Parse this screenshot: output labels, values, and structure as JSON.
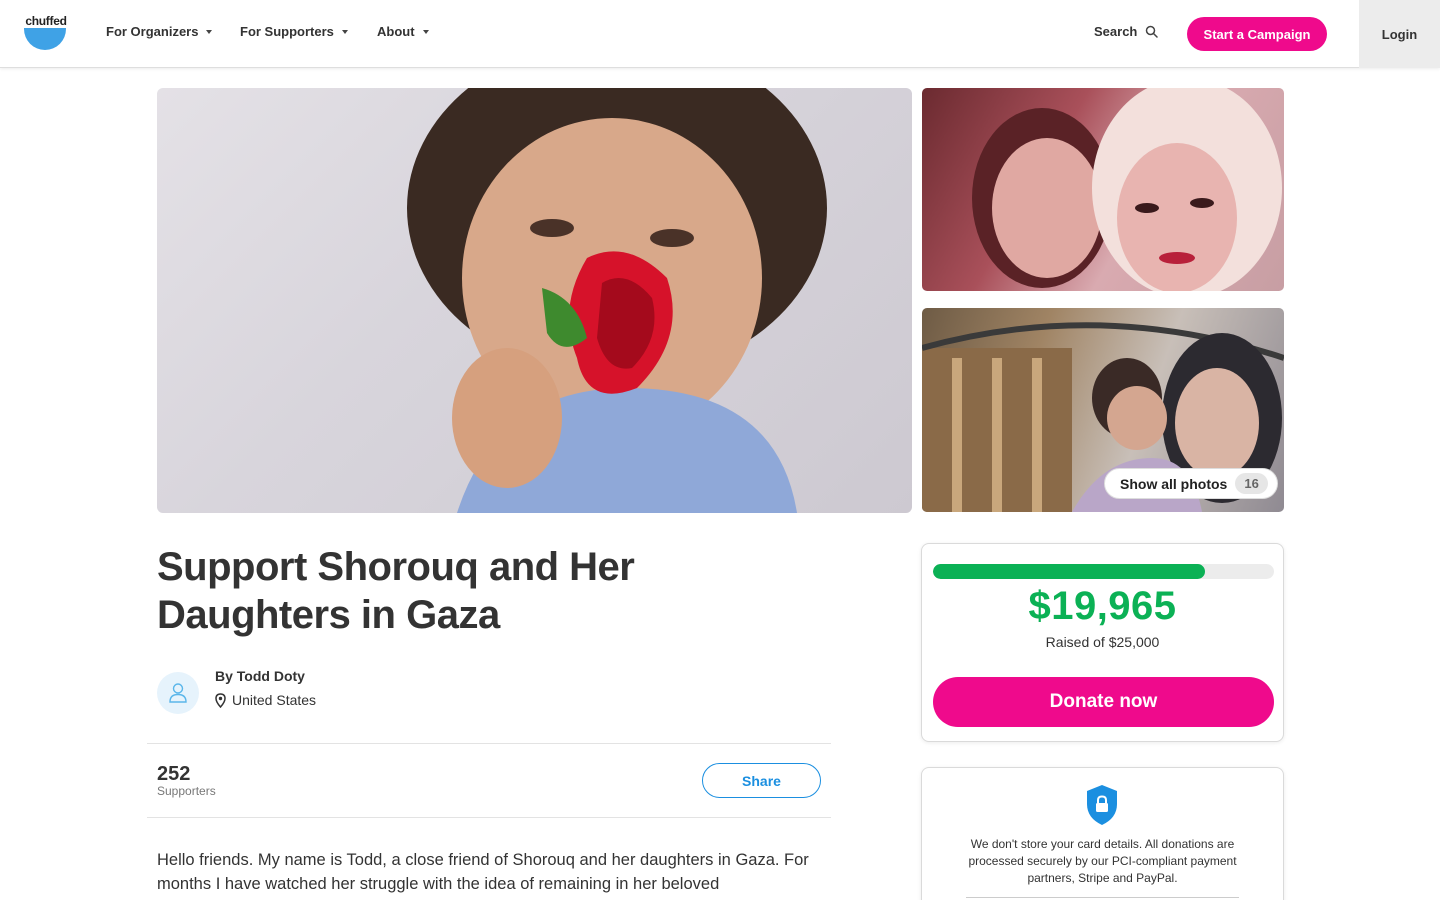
{
  "brand": {
    "logo_text": "chuffed",
    "accent": "#ef0a8c",
    "logo_blue": "#3fa2e6",
    "progress_green": "#0bb155"
  },
  "nav": {
    "items": [
      {
        "label": "For Organizers"
      },
      {
        "label": "For Supporters"
      },
      {
        "label": "About"
      }
    ],
    "search_label": "Search",
    "start_campaign_label": "Start a Campaign",
    "login_label": "Login"
  },
  "gallery": {
    "show_all_label": "Show all photos",
    "photo_count": "16"
  },
  "campaign": {
    "title": "Support Shorouq and Her Daughters in Gaza",
    "organizer": "By Todd Doty",
    "location": "United States",
    "supporters_count": "252",
    "supporters_label": "Supporters",
    "share_label": "Share",
    "story": "Hello friends. My name is Todd, a close friend of Shorouq and her daughters in Gaza. For months I have watched her struggle with the idea of remaining in her beloved"
  },
  "donation": {
    "raised": "$19,965",
    "goal_text": "Raised of $25,000",
    "progress_fraction": 0.7986,
    "donate_label": "Donate now"
  },
  "security": {
    "text": "We don't store your card details. All donations are processed securely by our PCI-compliant payment partners, Stripe and PayPal."
  }
}
